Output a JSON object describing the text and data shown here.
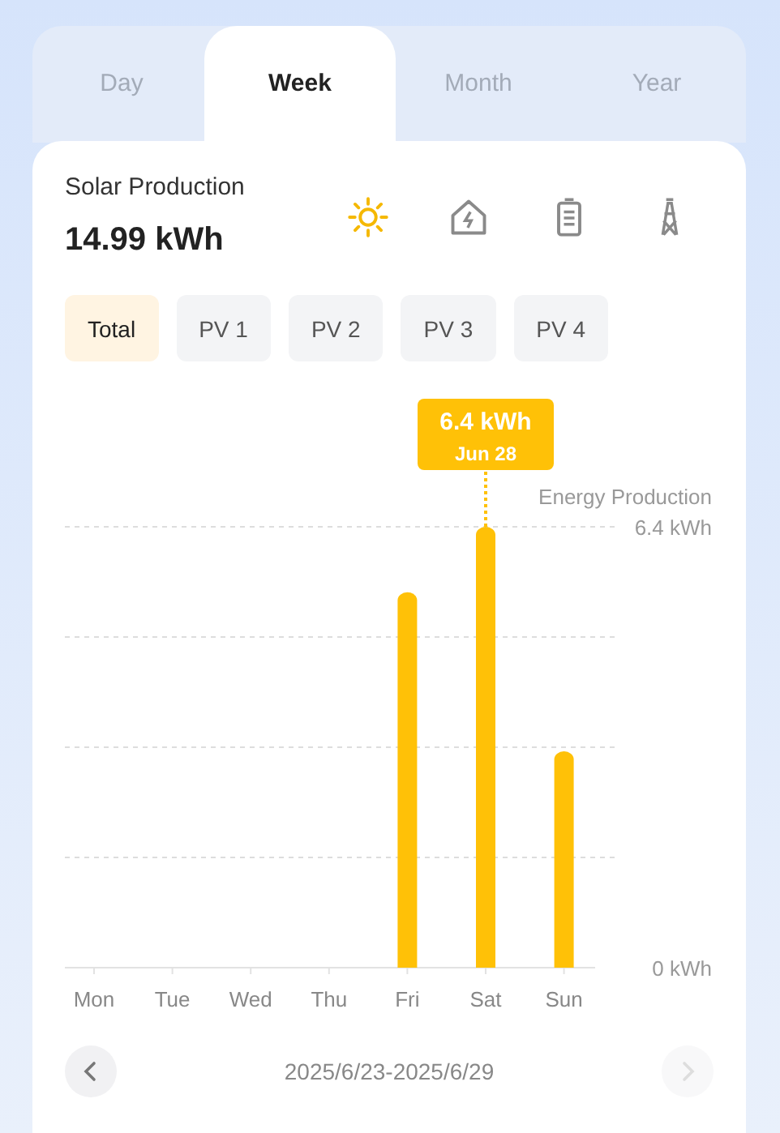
{
  "tabs": [
    {
      "label": "Day",
      "selected": false
    },
    {
      "label": "Week",
      "selected": true
    },
    {
      "label": "Month",
      "selected": false
    },
    {
      "label": "Year",
      "selected": false
    }
  ],
  "summary": {
    "title": "Solar Production",
    "value": "14.99 kWh"
  },
  "icons": [
    {
      "kind": "sun",
      "selected": true
    },
    {
      "kind": "home",
      "selected": false
    },
    {
      "kind": "battery",
      "selected": false
    },
    {
      "kind": "tower",
      "selected": false
    }
  ],
  "filters": [
    {
      "label": "Total",
      "selected": true
    },
    {
      "label": "PV 1",
      "selected": false
    },
    {
      "label": "PV 2",
      "selected": false
    },
    {
      "label": "PV 3",
      "selected": false
    },
    {
      "label": "PV 4",
      "selected": false
    }
  ],
  "chart": {
    "tooltip": {
      "value": "6.4 kWh",
      "date": "Jun 28"
    },
    "chart_data": {
      "type": "bar",
      "categories": [
        "Mon",
        "Tue",
        "Wed",
        "Thu",
        "Fri",
        "Sat",
        "Sun"
      ],
      "series": [
        {
          "name": "Energy Production",
          "color": "#ffc107",
          "values": [
            0,
            0,
            0,
            0,
            5.45,
            6.4,
            3.14
          ]
        }
      ],
      "ylim": [
        0,
        6.4
      ],
      "yticks": [
        {
          "value": 0,
          "label": "0 kWh"
        },
        {
          "value": 6.4,
          "label": "6.4 kWh"
        }
      ]
    }
  },
  "range": {
    "label": "2025/6/23-2025/6/29",
    "prev_disabled": false,
    "next_disabled": true
  }
}
